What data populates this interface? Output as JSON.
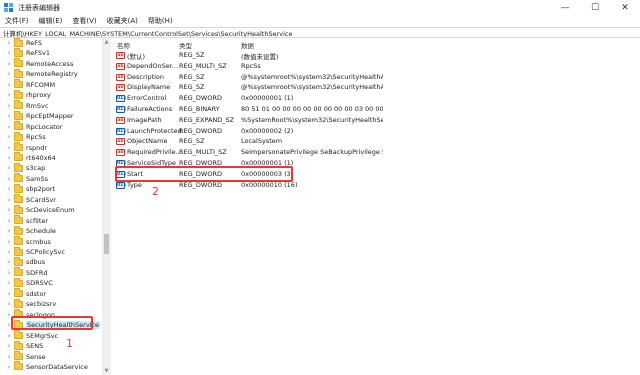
{
  "window": {
    "title": "注册表编辑器",
    "minimize": "—",
    "maximize": "☐",
    "close": "✕"
  },
  "menu": [
    "文件(F)",
    "编辑(E)",
    "查看(V)",
    "收藏夹(A)",
    "帮助(H)"
  ],
  "address": "计算机\\HKEY_LOCAL_MACHINE\\SYSTEM\\CurrentControlSet\\Services\\SecurityHealthService",
  "tree": {
    "items": [
      {
        "label": "ReFS"
      },
      {
        "label": "ReFSv1"
      },
      {
        "label": "RemoteAccess"
      },
      {
        "label": "RemoteRegistry"
      },
      {
        "label": "RFCOMM"
      },
      {
        "label": "rhproxy"
      },
      {
        "label": "RmSvc"
      },
      {
        "label": "RpcEptMapper"
      },
      {
        "label": "RpcLocator"
      },
      {
        "label": "RpcSs"
      },
      {
        "label": "rspndr"
      },
      {
        "label": "rt640x64"
      },
      {
        "label": "s3cap"
      },
      {
        "label": "SamSs"
      },
      {
        "label": "sbp2port"
      },
      {
        "label": "SCardSvr"
      },
      {
        "label": "ScDeviceEnum"
      },
      {
        "label": "scfilter"
      },
      {
        "label": "Schedule"
      },
      {
        "label": "scmbus"
      },
      {
        "label": "SCPolicySvc"
      },
      {
        "label": "sdbus"
      },
      {
        "label": "SDFRd"
      },
      {
        "label": "SDRSVC"
      },
      {
        "label": "sdstor"
      },
      {
        "label": "secbizsrv"
      },
      {
        "label": "seclogon"
      },
      {
        "label": "SecurityHealthService",
        "selected": true
      },
      {
        "label": "SEMgrSvc"
      },
      {
        "label": "SENS"
      },
      {
        "label": "Sense"
      },
      {
        "label": "SensorDataService"
      }
    ]
  },
  "columns": {
    "name": "名称",
    "type": "类型",
    "data": "数据"
  },
  "values": [
    {
      "name": "(默认)",
      "type": "REG_SZ",
      "data": "(数值未设置)",
      "kind": "str"
    },
    {
      "name": "DependOnSer...",
      "type": "REG_MULTI_SZ",
      "data": "RpcSs",
      "kind": "str"
    },
    {
      "name": "Description",
      "type": "REG_SZ",
      "data": "@%systemroot%\\system32\\SecurityHealthAg...",
      "kind": "str"
    },
    {
      "name": "DisplayName",
      "type": "REG_SZ",
      "data": "@%systemroot%\\system32\\SecurityHealthAg...",
      "kind": "str"
    },
    {
      "name": "ErrorControl",
      "type": "REG_DWORD",
      "data": "0x00000001 (1)",
      "kind": "bin"
    },
    {
      "name": "FailureActions",
      "type": "REG_BINARY",
      "data": "80 51 01 00 00 00 00 00 00 00 00 03 00 00...",
      "kind": "bin"
    },
    {
      "name": "ImagePath",
      "type": "REG_EXPAND_SZ",
      "data": "%SystemRoot%\\system32\\SecurityHealthServi...",
      "kind": "str"
    },
    {
      "name": "LaunchProtected",
      "type": "REG_DWORD",
      "data": "0x00000002 (2)",
      "kind": "bin"
    },
    {
      "name": "ObjectName",
      "type": "REG_SZ",
      "data": "LocalSystem",
      "kind": "str"
    },
    {
      "name": "RequiredPrivile...",
      "type": "REG_MULTI_SZ",
      "data": "SeImpersonatePrivilege SeBackupPrivilege Se...",
      "kind": "str"
    },
    {
      "name": "ServiceSidType",
      "type": "REG_DWORD",
      "data": "0x00000001 (1)",
      "kind": "bin"
    },
    {
      "name": "Start",
      "type": "REG_DWORD",
      "data": "0x00000003 (3)",
      "kind": "bin",
      "highlight": true
    },
    {
      "name": "Type",
      "type": "REG_DWORD",
      "data": "0x00000010 (16)",
      "kind": "bin"
    }
  ],
  "annotations": {
    "one": "1",
    "two": "2"
  },
  "colors": {
    "highlight": "#e53935",
    "selection": "#cce8ff",
    "folder": "#f0c850",
    "icon_string": "#c0392b",
    "icon_binary": "#1a56b0"
  },
  "icons": {
    "string_value": "ab",
    "binary_value": "011"
  }
}
